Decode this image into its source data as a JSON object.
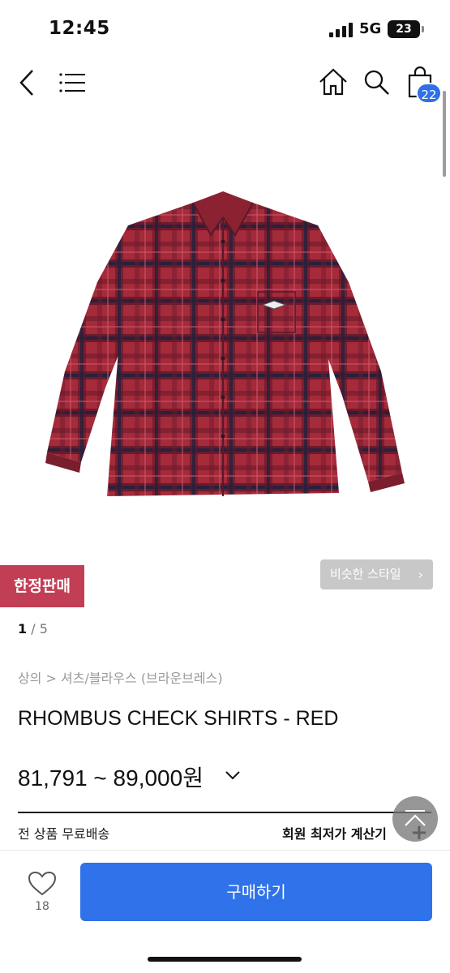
{
  "status_bar": {
    "time": "12:45",
    "network": "5G",
    "battery": "23"
  },
  "nav": {
    "cart_count": "22"
  },
  "product": {
    "image_alt_color": "#8b2233",
    "limited_badge": "한정판매",
    "similar_style": "비슷한 스타일",
    "page_current": "1",
    "page_total": "/ 5",
    "breadcrumb": "상의 > 셔츠/블라우스 (브라운브레스)",
    "title": "RHOMBUS CHECK SHIRTS - RED",
    "price": "81,791 ~ 89,000원"
  },
  "info": {
    "shipping": "전 상품 무료배송",
    "member_price": "회원 최저가 계산기",
    "member_plus": "+"
  },
  "bottom": {
    "like_count": "18",
    "buy_label": "구매하기"
  },
  "colors": {
    "accent_blue": "#2f72ea",
    "badge_red": "#c23e55",
    "shirt_red": "#a52a3a",
    "shirt_navy": "#1f2140"
  }
}
